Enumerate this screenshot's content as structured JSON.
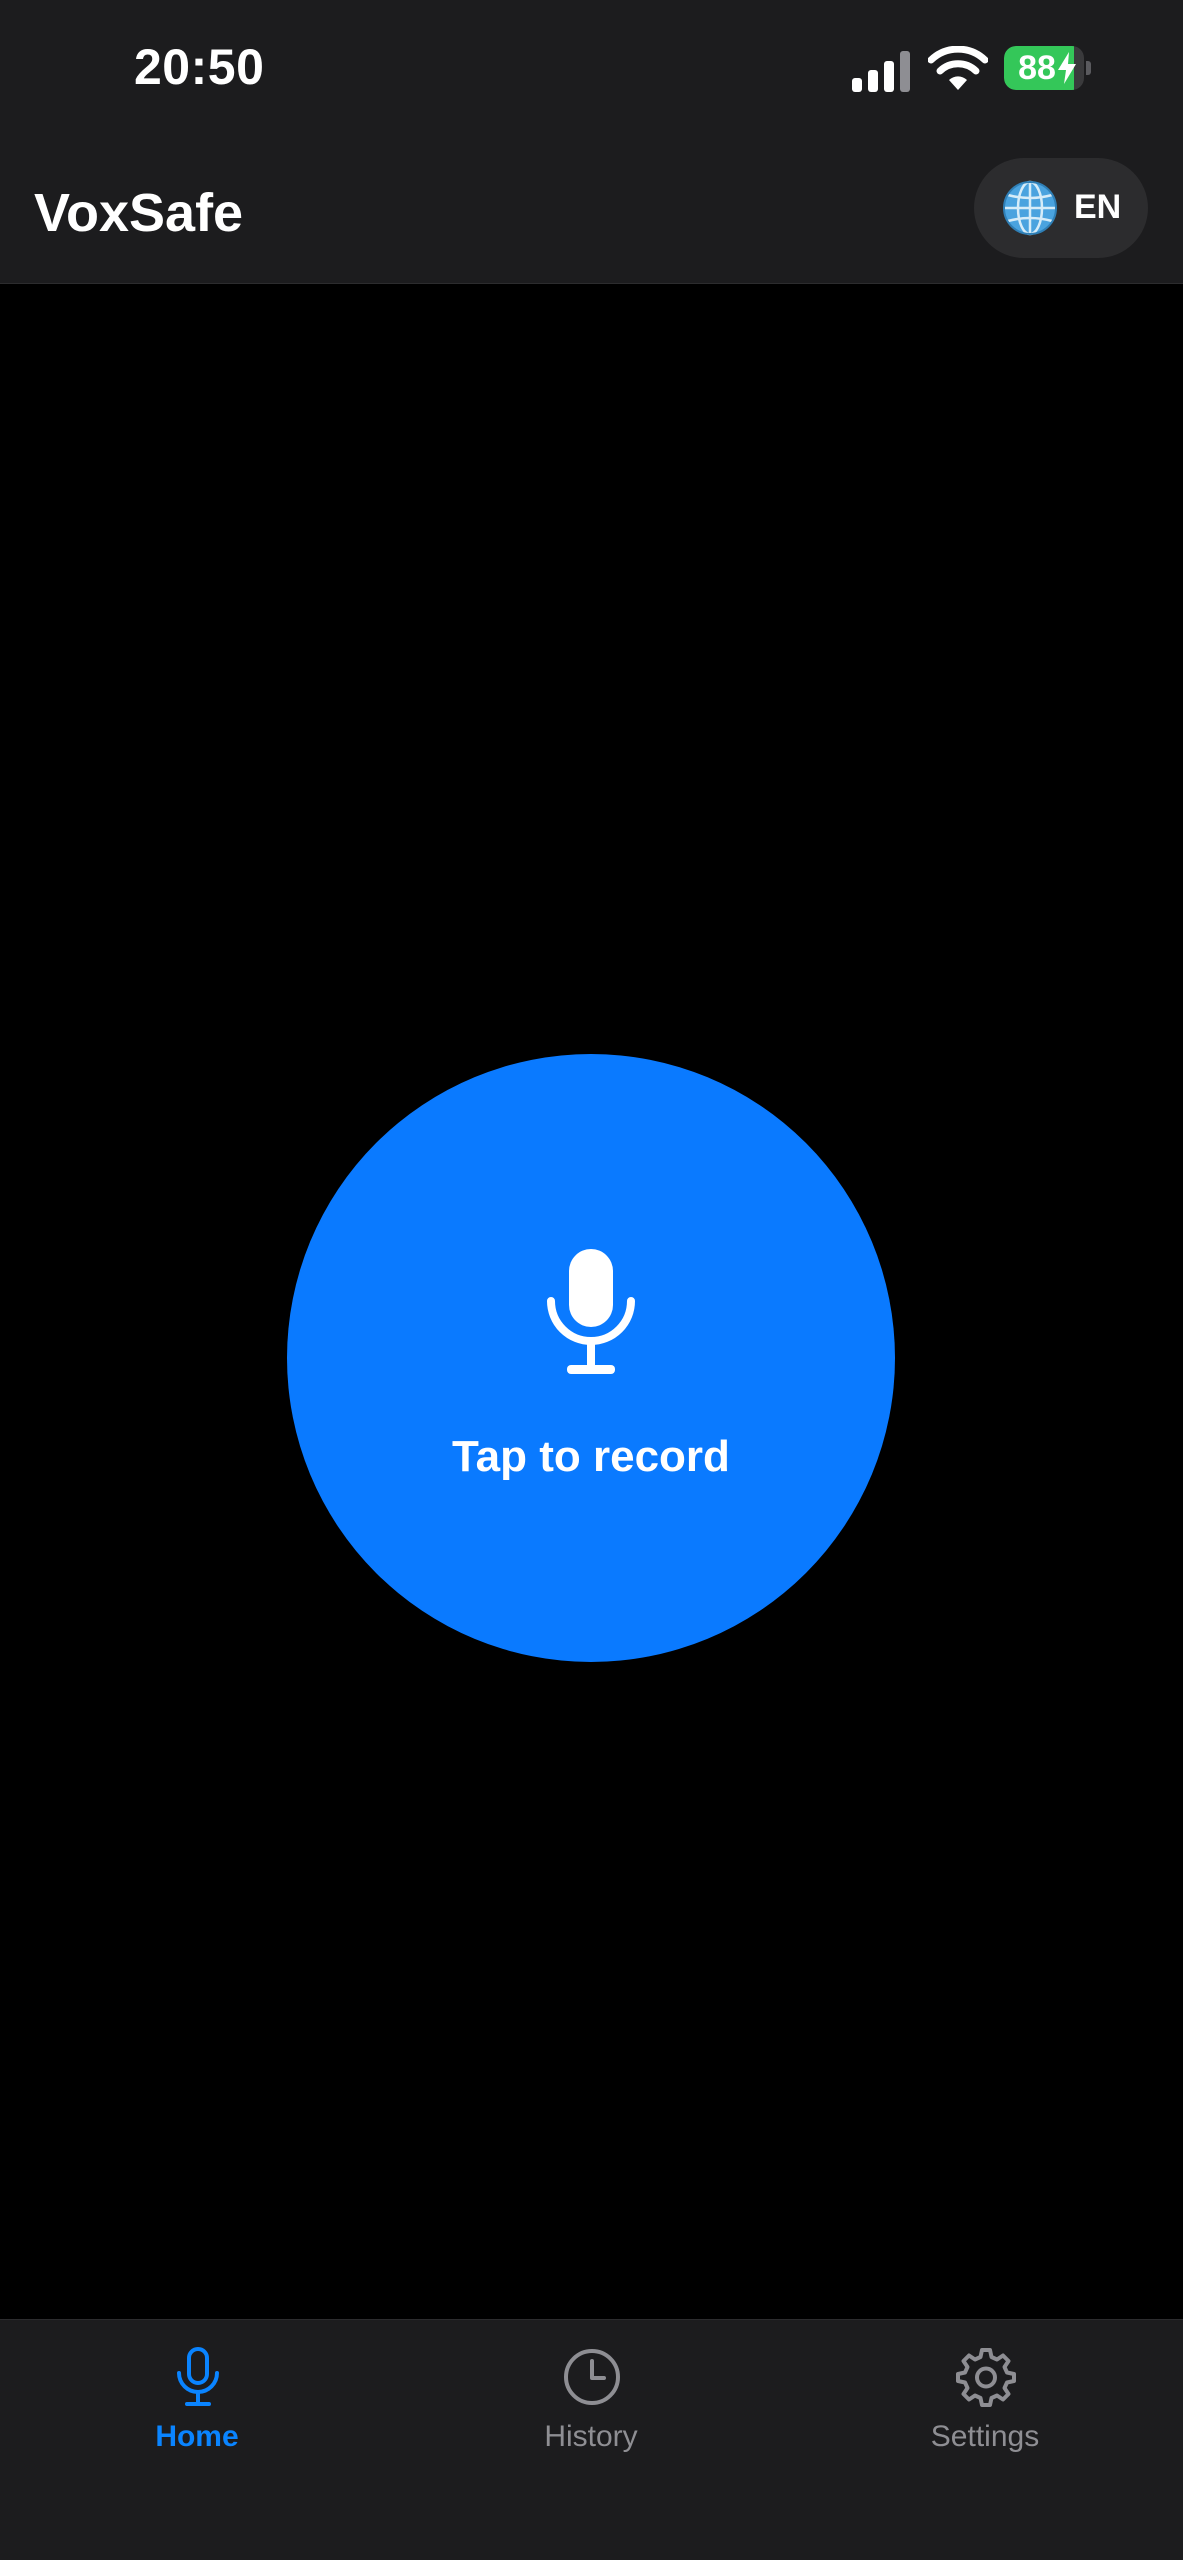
{
  "status_bar": {
    "time": "20:50",
    "signal_icon": "cellular-signal-icon",
    "wifi_icon": "wifi-icon",
    "battery_level": "88",
    "battery_fraction": 0.88,
    "battery_charging_icon": "bolt-icon",
    "battery_color": "#34c759"
  },
  "header": {
    "title": "VoxSafe",
    "language_icon": "globe-icon",
    "language_code": "EN"
  },
  "main": {
    "record_icon": "microphone-icon",
    "record_label": "Tap to record",
    "accent_color": "#0a7aff"
  },
  "tab_bar": {
    "tabs": [
      {
        "label": "Home",
        "icon": "microphone-icon",
        "active": true
      },
      {
        "label": "History",
        "icon": "clock-icon",
        "active": false
      },
      {
        "label": "Settings",
        "icon": "gear-icon",
        "active": false
      }
    ],
    "active_color": "#0a84ff",
    "inactive_color": "#8e8e93"
  }
}
